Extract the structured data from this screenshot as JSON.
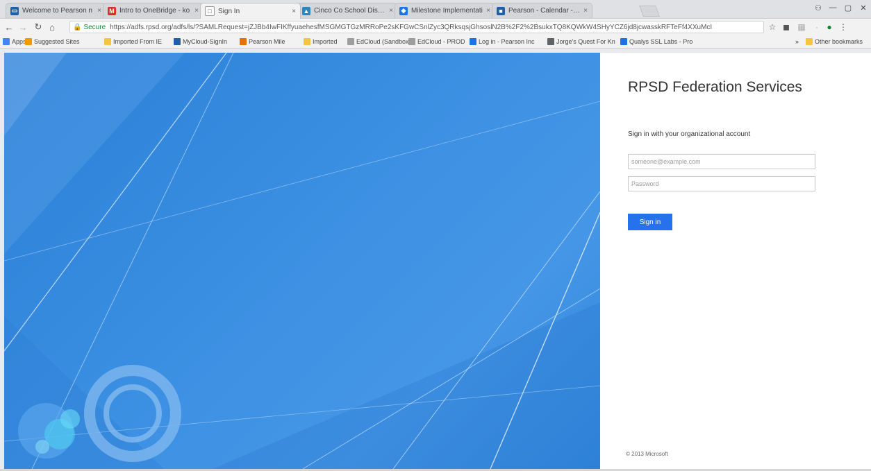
{
  "browser": {
    "tabs": [
      {
        "label": "Welcome to Pearson n",
        "color": "#1f5fa8",
        "glyph": "▭"
      },
      {
        "label": "Intro to OneBridge - ko",
        "color": "#d93025",
        "glyph": "M"
      },
      {
        "label": "Sign In",
        "color": "#ffffff",
        "glyph": "□"
      },
      {
        "label": "Cinco Co School Distric",
        "color": "#2e86c1",
        "glyph": "▲"
      },
      {
        "label": "Milestone Implementati",
        "color": "#1a73e8",
        "glyph": "◆"
      },
      {
        "label": "Pearson - Calendar - Wi",
        "color": "#1f5fa8",
        "glyph": "■"
      }
    ],
    "active_tab_index": 2,
    "address": {
      "secure_label": "Secure",
      "url": "https://adfs.rpsd.org/adfs/ls/?SAMLRequest=jZJBb4IwFIKffyuaehesfMSGMGTGzMRRoPe2sKFGwCSnlZyc3QRksqsjGhsoslN2B%2F2%2BsukxTQ8KQWkW4SHyYCZ6jd8jcwasskRFTeFf4XXuMcI"
    },
    "bookmarks": [
      {
        "label": "Apps",
        "color": "#4285f4"
      },
      {
        "label": "Suggested Sites",
        "color": "#f29900"
      },
      {
        "label": "Imported From IE",
        "color": "#f4c542"
      },
      {
        "label": "MyCloud-SignIn",
        "color": "#1f5fa8"
      },
      {
        "label": "Pearson Mile",
        "color": "#e37400"
      },
      {
        "label": "Imported",
        "color": "#f4c542"
      },
      {
        "label": "EdCloud (Sandbox)",
        "color": "#9e9e9e"
      },
      {
        "label": "EdCloud - PROD",
        "color": "#9e9e9e"
      },
      {
        "label": "Log in - Pearson Inc",
        "color": "#1a73e8"
      },
      {
        "label": "Jorge's Quest For Kn",
        "color": "#5f6368"
      },
      {
        "label": "Qualys SSL Labs - Pro",
        "color": "#1a73e8"
      }
    ],
    "bookmarks_overflow": "»",
    "other_bookmarks": "Other bookmarks"
  },
  "page": {
    "title": "RPSD Federation Services",
    "intro": "Sign in with your organizational account",
    "username": {
      "value": "",
      "placeholder": "someone@example.com"
    },
    "password": {
      "value": "",
      "placeholder": "Password"
    },
    "submit_label": "Sign in",
    "footer": "© 2013 Microsoft"
  },
  "colors": {
    "accent": "#2672ec",
    "hero": "#3b8fe2"
  }
}
